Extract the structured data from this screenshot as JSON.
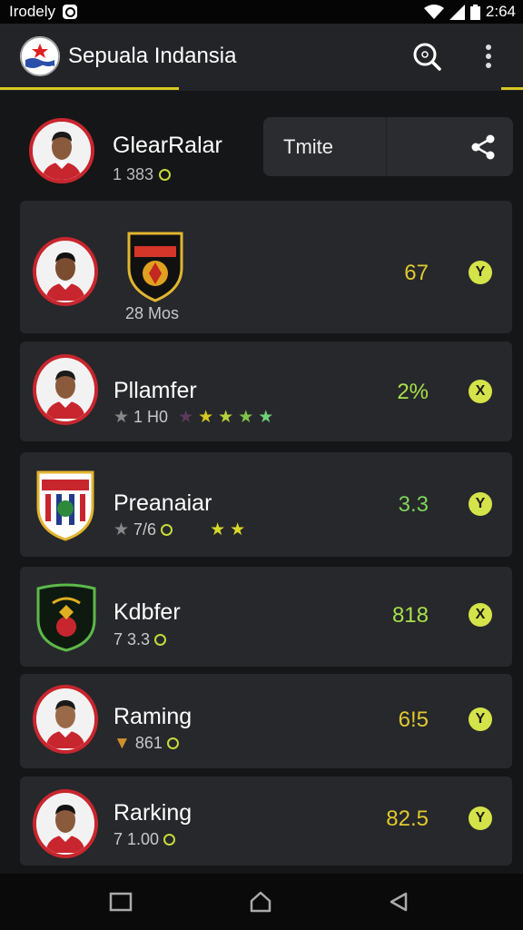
{
  "status_bar": {
    "carrier": "Irodely",
    "time": "2:64",
    "icons": [
      "notification-icon",
      "wifi-icon",
      "signal-icon",
      "battery-icon"
    ]
  },
  "app_bar": {
    "title": "Sepuala Indansia",
    "icons": [
      "search-icon",
      "more-vert-icon"
    ]
  },
  "top_player": {
    "name": "GlearRalar",
    "meta": "1 383",
    "action_label": "Tmite",
    "share_icon": "share-icon"
  },
  "cards": [
    {
      "type": "team",
      "name": "",
      "meta": "28 Mos",
      "score": "67",
      "score_color": "#e0c92e",
      "action": "Y"
    },
    {
      "type": "player",
      "name": "Pllamfer",
      "meta": "1 H0",
      "score": "2%",
      "score_color": "#a8e04a",
      "action": "X",
      "stars": 4
    },
    {
      "type": "crest",
      "name": "Preanaiar",
      "meta": "7/6",
      "score": "3.3",
      "score_color": "#7fd35a",
      "action": "Y",
      "stars": 2
    },
    {
      "type": "crest2",
      "name": "Kdbfer",
      "meta": "7 3.3",
      "score": "818",
      "score_color": "#a8e04a",
      "action": "X"
    },
    {
      "type": "player",
      "name": "Raming",
      "meta": "861",
      "score": "6!5",
      "score_color": "#e0c92e",
      "action": "Y"
    },
    {
      "type": "player",
      "name": "Rarking",
      "meta": "7 1.00",
      "score": "82.5",
      "score_color": "#e0c92e",
      "action": "Y"
    }
  ],
  "colors": {
    "accent": "#d8c81f",
    "action_badge": "#d4e34a",
    "card_bg": "#26282b",
    "avatar_ring": "#c8262e"
  },
  "nav_bar": {
    "icons": [
      "recents-icon",
      "home-icon",
      "back-icon"
    ]
  }
}
